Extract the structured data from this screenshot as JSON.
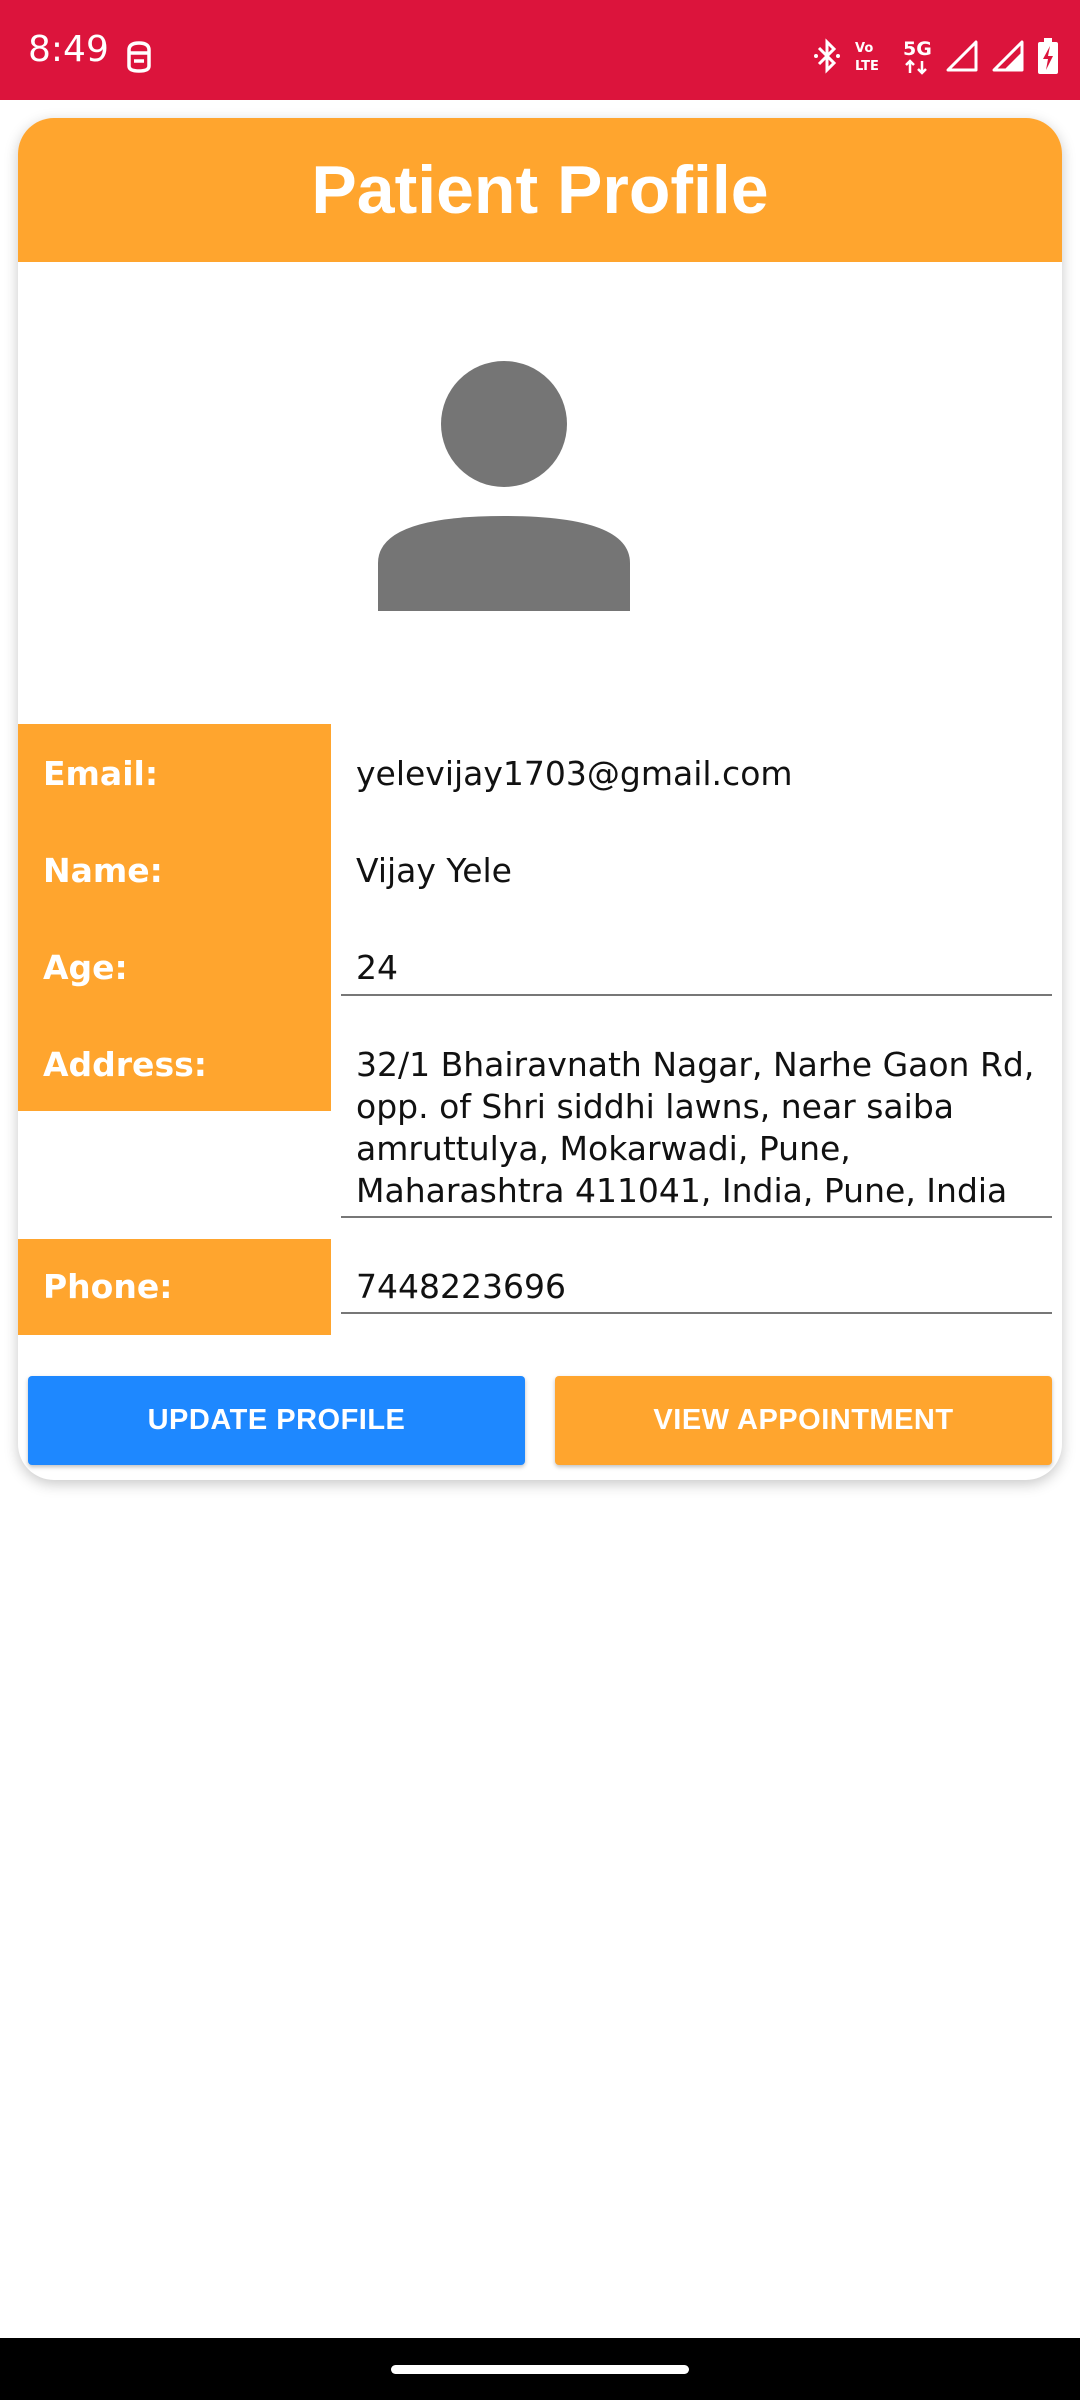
{
  "status_bar": {
    "time": "8:49",
    "app_icon": "notification-app-icon",
    "icons": [
      "bluetooth-icon",
      "volte-icon",
      "5g-icon",
      "signal-icon",
      "signal-icon-2",
      "battery-charging-icon"
    ],
    "color": "#DC143C"
  },
  "header": {
    "title": "Patient Profile",
    "color": "#FFA52E"
  },
  "avatar": {
    "icon": "person-icon",
    "color": "#757575"
  },
  "profile": {
    "email_label": "Email:",
    "email_value": "yelevijay1703@gmail.com",
    "name_label": "Name:",
    "name_value": "Vijay Yele",
    "age_label": "Age:",
    "age_value": "24",
    "address_label": "Address:",
    "address_value": "32/1 Bhairavnath Nagar, Narhe Gaon Rd, opp. of Shri siddhi lawns, near saiba amruttulya, Mokarwadi, Pune, Maharashtra 411041, India, Pune, India",
    "phone_label": "Phone:",
    "phone_value": "7448223696"
  },
  "buttons": {
    "update_label": "UPDATE PROFILE",
    "update_color": "#1E88FF",
    "view_label": "VIEW APPOINTMENT",
    "view_color": "#FFA52E"
  }
}
